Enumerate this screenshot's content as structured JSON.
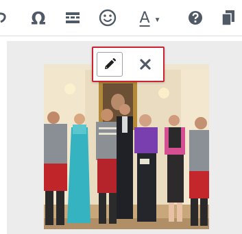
{
  "toolbar": {
    "omega_glyph": "Ω",
    "font_color_letter": "A",
    "colors": {
      "icon": "#505a66"
    }
  },
  "image_popup": {
    "edit_icon": "pencil-icon",
    "close_icon": "close-icon",
    "border_color": "#cc2233"
  },
  "editor": {
    "background": "#ececec",
    "image_content": "group-photo-of-people-in-formal-attire"
  }
}
